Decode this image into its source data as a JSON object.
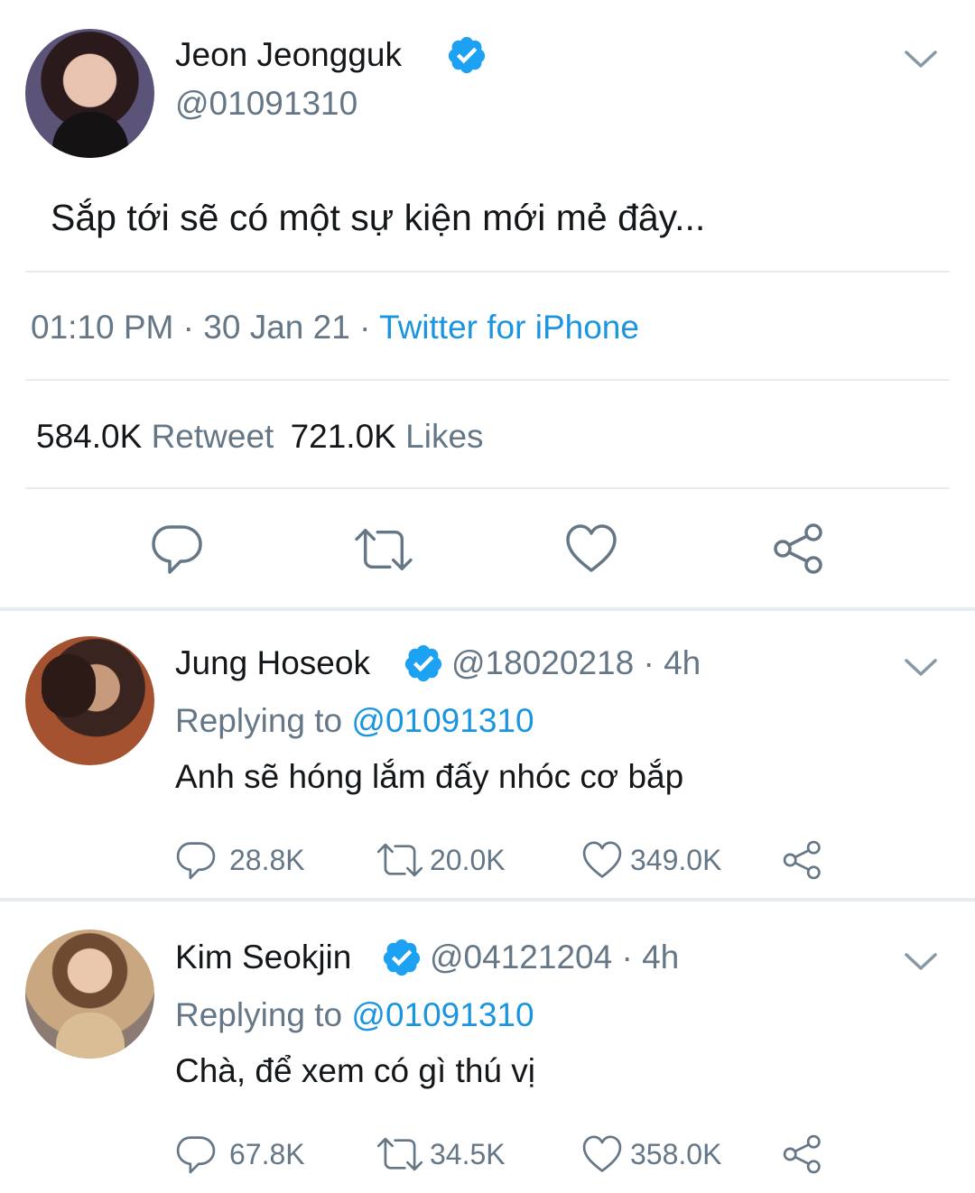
{
  "main_tweet": {
    "author_name": "Jeon Jeongguk",
    "handle": "@01091310",
    "text": "Sắp tới sẽ có một sự kiện mới mẻ đây...",
    "time": "01:10 PM",
    "date": "30 Jan 21",
    "source": "Twitter for iPhone",
    "separator": "·",
    "retweet_count": "584.0K",
    "retweet_label": "Retweet",
    "like_count": "721.0K",
    "like_label": "Likes"
  },
  "replies": [
    {
      "author_name": "Jung Hoseok",
      "handle": "@18020218",
      "time_ago": "· 4h",
      "replying_label": "Replying to",
      "replying_to": "@01091310",
      "text": "Anh sẽ hóng lắm đấy nhóc cơ bắp",
      "reply_count": "28.8K",
      "retweet_count": "20.0K",
      "like_count": "349.0K"
    },
    {
      "author_name": "Kim Seokjin",
      "handle": "@04121204",
      "time_ago": "· 4h",
      "replying_label": "Replying to",
      "replying_to": "@01091310",
      "text": "Chà, để xem có gì thú vị",
      "reply_count": "67.8K",
      "retweet_count": "34.5K",
      "like_count": "358.0K"
    }
  ],
  "icons": [
    "verified-icon",
    "chevron-down-icon",
    "reply-icon",
    "retweet-icon",
    "like-icon",
    "share-icon"
  ],
  "colors": {
    "accent": "#1da1f2",
    "link": "#1b95e0",
    "secondary_text": "#657786",
    "divider": "#e6ecf0"
  }
}
